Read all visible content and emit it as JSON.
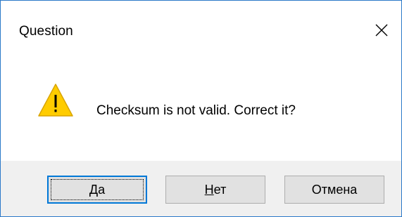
{
  "window": {
    "title": "Question",
    "close_icon": "close-icon"
  },
  "content": {
    "icon": "warning-icon",
    "message": "Checksum is not valid. Correct it?"
  },
  "buttons": {
    "yes": {
      "mnemonic": "Д",
      "rest": "а"
    },
    "no": {
      "mnemonic": "Н",
      "rest": "ет"
    },
    "cancel": {
      "label": "Отмена"
    }
  },
  "colors": {
    "window_border": "#2b79c9",
    "footer_bg": "#f0f0f0",
    "default_button_border": "#0078d7",
    "warning_fill": "#ffcc00",
    "warning_outline": "#d9a400"
  }
}
